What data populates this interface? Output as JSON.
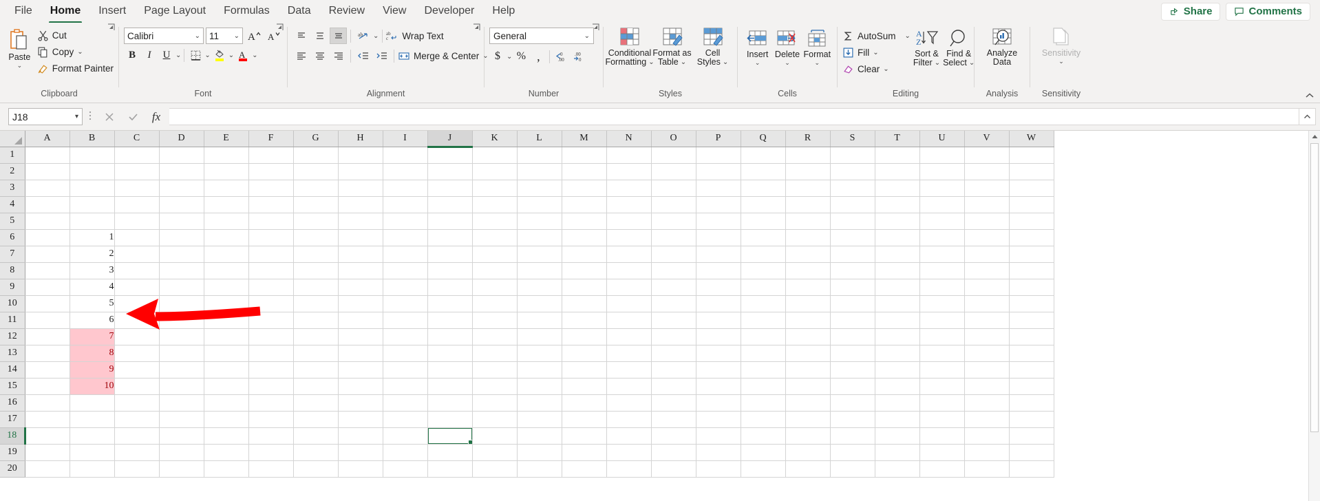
{
  "app": {
    "accent": "#217346",
    "bad_fill": "#FFC7CE",
    "bad_text": "#9C0006",
    "annotation_color": "#FF0000"
  },
  "tabs": [
    {
      "label": "File",
      "active": false
    },
    {
      "label": "Home",
      "active": true
    },
    {
      "label": "Insert",
      "active": false
    },
    {
      "label": "Page Layout",
      "active": false
    },
    {
      "label": "Formulas",
      "active": false
    },
    {
      "label": "Data",
      "active": false
    },
    {
      "label": "Review",
      "active": false
    },
    {
      "label": "View",
      "active": false
    },
    {
      "label": "Developer",
      "active": false
    },
    {
      "label": "Help",
      "active": false
    }
  ],
  "titlebar": {
    "share_label": "Share",
    "comments_label": "Comments"
  },
  "ribbon": {
    "groups": [
      {
        "name": "clipboard",
        "label": "Clipboard",
        "has_launcher": true
      },
      {
        "name": "font",
        "label": "Font",
        "has_launcher": true
      },
      {
        "name": "alignment",
        "label": "Alignment",
        "has_launcher": true
      },
      {
        "name": "number",
        "label": "Number",
        "has_launcher": true
      },
      {
        "name": "styles",
        "label": "Styles",
        "has_launcher": false
      },
      {
        "name": "cells",
        "label": "Cells",
        "has_launcher": false
      },
      {
        "name": "editing",
        "label": "Editing",
        "has_launcher": false
      },
      {
        "name": "analysis",
        "label": "Analysis",
        "has_launcher": false
      },
      {
        "name": "sensitivity",
        "label": "Sensitivity",
        "has_launcher": false
      }
    ],
    "clipboard": {
      "paste": "Paste",
      "cut": "Cut",
      "copy": "Copy",
      "format_painter": "Format Painter"
    },
    "font": {
      "font_name": "Calibri",
      "font_size": "11",
      "grow_font": "A",
      "shrink_font": "A",
      "bold": "B",
      "italic": "I",
      "underline": "U"
    },
    "alignment": {
      "wrap_text": "Wrap Text",
      "merge_center": "Merge & Center"
    },
    "number": {
      "format": "General",
      "accounting": "$",
      "percent": "%",
      "comma": ",",
      "increase_decimal": ".00",
      "decrease_decimal": ".00"
    },
    "styles": {
      "conditional_formatting_l1": "Conditional",
      "conditional_formatting_l2": "Formatting",
      "format_as_table_l1": "Format as",
      "format_as_table_l2": "Table",
      "cell_styles_l1": "Cell",
      "cell_styles_l2": "Styles"
    },
    "cells": {
      "insert": "Insert",
      "delete": "Delete",
      "format": "Format"
    },
    "editing": {
      "autosum": "AutoSum",
      "fill": "Fill",
      "clear": "Clear",
      "sort_filter_l1": "Sort &",
      "sort_filter_l2": "Filter",
      "find_select_l1": "Find &",
      "find_select_l2": "Select"
    },
    "analysis": {
      "analyze_data_l1": "Analyze",
      "analyze_data_l2": "Data"
    },
    "sensitivity": {
      "label": "Sensitivity"
    }
  },
  "formula_bar": {
    "name_box": "J18",
    "formula_value": "",
    "cancel_icon": "×",
    "enter_icon": "✓",
    "function_icon": "fx"
  },
  "grid": {
    "columns": [
      "A",
      "B",
      "C",
      "D",
      "E",
      "F",
      "G",
      "H",
      "I",
      "J",
      "K",
      "L",
      "M",
      "N",
      "O",
      "P",
      "Q",
      "R",
      "S",
      "T",
      "U",
      "V",
      "W"
    ],
    "active_column": "J",
    "rows": [
      1,
      2,
      3,
      4,
      5,
      6,
      7,
      8,
      9,
      10,
      11,
      12,
      13,
      14,
      15,
      16,
      17,
      18,
      19,
      20
    ],
    "active_row": 18,
    "selected_cell": "J18",
    "cell_values": {
      "B6": "1",
      "B7": "2",
      "B8": "3",
      "B9": "4",
      "B10": "5",
      "B11": "6",
      "B12": "7",
      "B13": "8",
      "B14": "9",
      "B15": "10"
    },
    "highlighted_cells": [
      "B12",
      "B13",
      "B14",
      "B15"
    ]
  }
}
